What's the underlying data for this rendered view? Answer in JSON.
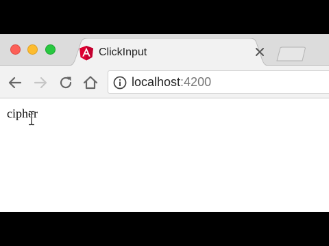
{
  "browser": {
    "tab": {
      "title": "ClickInput",
      "favicon": "angular-icon"
    },
    "address_bar": {
      "host": "localhost",
      "port": ":4200"
    },
    "toolbar_icons": [
      "back-arrow-icon",
      "forward-arrow-icon",
      "reload-icon",
      "home-icon",
      "info-icon"
    ]
  },
  "page": {
    "text": "cipher",
    "cursor": "text-ibeam"
  },
  "colors": {
    "close": "#fc5f57",
    "minimize": "#fdbc2e",
    "maximize": "#28c840",
    "angular_red": "#dd0031"
  }
}
